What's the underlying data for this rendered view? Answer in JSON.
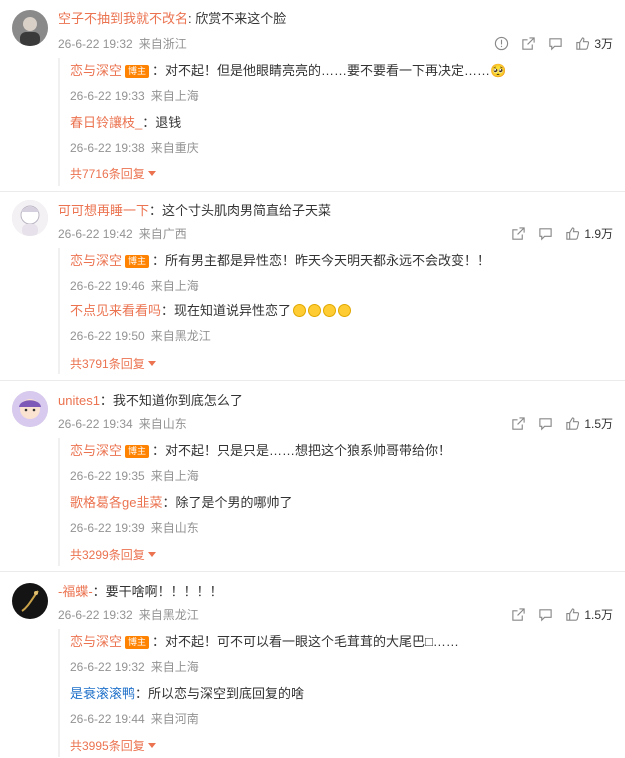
{
  "comments": [
    {
      "username": "空子不抽到我就不改名",
      "content": ": 欣赏不来这个脸",
      "time": "26-6-22 19:32",
      "location": "来自浙江",
      "likes": "3万",
      "avatar_icon": "avatar-dark-icon",
      "replies": [
        {
          "username": "恋与深空",
          "badge": "博主",
          "content": "：对不起！但是他眼睛亮亮的……要不要看一下再决定……🥺",
          "time": "26-6-22 19:33",
          "location": "来自上海"
        },
        {
          "username": "春日铃讓枝_",
          "content": "：退钱",
          "time": "26-6-22 19:38",
          "location": "来自重庆"
        }
      ],
      "more": "共7716条回复"
    },
    {
      "username": "可可想再睡一下",
      "content": "：这个寸头肌肉男简直给子天菜",
      "time": "26-6-22 19:42",
      "location": "来自广西",
      "likes": "1.9万",
      "avatar_icon": "avatar-anime-icon",
      "replies": [
        {
          "username": "恋与深空",
          "badge": "博主",
          "content": "：所有男主都是异性恋！昨天今天明天都永远不会改变！！",
          "time": "26-6-22 19:46",
          "location": "来自上海"
        },
        {
          "username": "不点见来看看吗",
          "content": "：现在知道说异性恋了",
          "time": "26-6-22 19:50",
          "location": "来自黑龙江"
        }
      ],
      "more": "共3791条回复"
    },
    {
      "username": "unites1",
      "content": "：我不知道你到底怎么了",
      "time": "26-6-22 19:34",
      "location": "来自山东",
      "likes": "1.5万",
      "avatar_icon": "avatar-cartoon-icon",
      "replies": [
        {
          "username": "恋与深空",
          "badge": "博主",
          "content": "：对不起！只是只是……想把这个狼系帅哥带给你！",
          "time": "26-6-22 19:35",
          "location": "来自上海"
        },
        {
          "username": "歌格葛各ge韭菜",
          "content": "：除了是个男的哪帅了",
          "time": "26-6-22 19:39",
          "location": "来自山东"
        }
      ],
      "more": "共3299条回复"
    },
    {
      "username": "-福蝶-",
      "content": "：要干啥啊！！！！！",
      "time": "26-6-22 19:32",
      "location": "来自黑龙江",
      "likes": "1.5万",
      "avatar_icon": "avatar-black-icon",
      "replies": [
        {
          "username": "恋与深空",
          "badge": "博主",
          "content": "：对不起！可不可以看一眼这个毛茸茸的大尾巴□……",
          "time": "26-6-22 19:32",
          "location": "来自上海"
        },
        {
          "username": "是衰滚滚鸭",
          "content": "：所以恋与深空到底回复的啥",
          "time": "26-6-22 19:44",
          "location": "来自河南"
        }
      ],
      "more": "共3995条回复"
    }
  ]
}
